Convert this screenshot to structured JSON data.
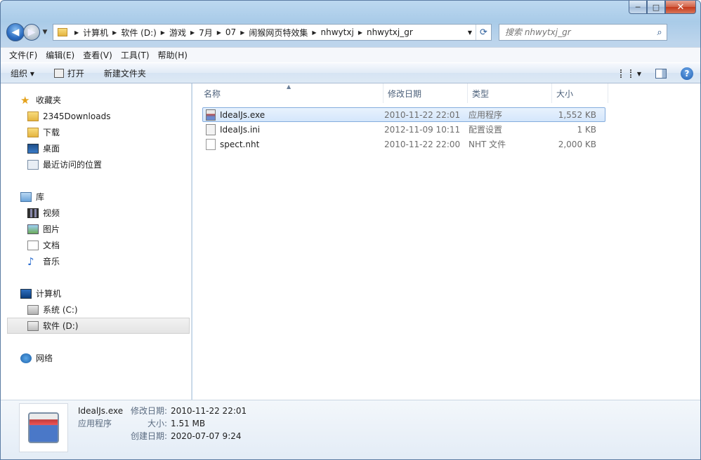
{
  "window": {
    "min_glyph": "─",
    "max_glyph": "□",
    "close_glyph": "✕"
  },
  "address": {
    "crumbs": [
      "计算机",
      "软件 (D:)",
      "游戏",
      "7月",
      "07",
      "闹猴网页特效集",
      "nhwytxj",
      "nhwytxj_gr"
    ]
  },
  "search": {
    "placeholder": "搜索 nhwytxj_gr"
  },
  "menu": [
    "文件(F)",
    "编辑(E)",
    "查看(V)",
    "工具(T)",
    "帮助(H)"
  ],
  "toolbar": {
    "organize": "组织 ▾",
    "open": "打开",
    "new_folder": "新建文件夹"
  },
  "nav": {
    "favorites": "收藏夹",
    "fav_items": [
      "2345Downloads",
      "下载",
      "桌面",
      "最近访问的位置"
    ],
    "libraries": "库",
    "lib_items": [
      "视频",
      "图片",
      "文档",
      "音乐"
    ],
    "computer": "计算机",
    "drives": [
      "系统 (C:)",
      "软件 (D:)"
    ],
    "network": "网络"
  },
  "columns": {
    "name": "名称",
    "date": "修改日期",
    "type": "类型",
    "size": "大小"
  },
  "files": [
    {
      "name": "IdealJs.exe",
      "date": "2010-11-22 22:01",
      "type": "应用程序",
      "size": "1,552 KB",
      "icon": "exe-icon"
    },
    {
      "name": "IdealJs.ini",
      "date": "2012-11-09 10:11",
      "type": "配置设置",
      "size": "1 KB",
      "icon": "ini-icon"
    },
    {
      "name": "spect.nht",
      "date": "2010-11-22 22:00",
      "type": "NHT 文件",
      "size": "2,000 KB",
      "icon": "file-icon"
    }
  ],
  "details": {
    "name": "IdealJs.exe",
    "kind": "应用程序",
    "modified_label": "修改日期:",
    "modified": "2010-11-22 22:01",
    "size_label": "大小:",
    "size": "1.51 MB",
    "created_label": "创建日期:",
    "created": "2020-07-07 9:24"
  }
}
